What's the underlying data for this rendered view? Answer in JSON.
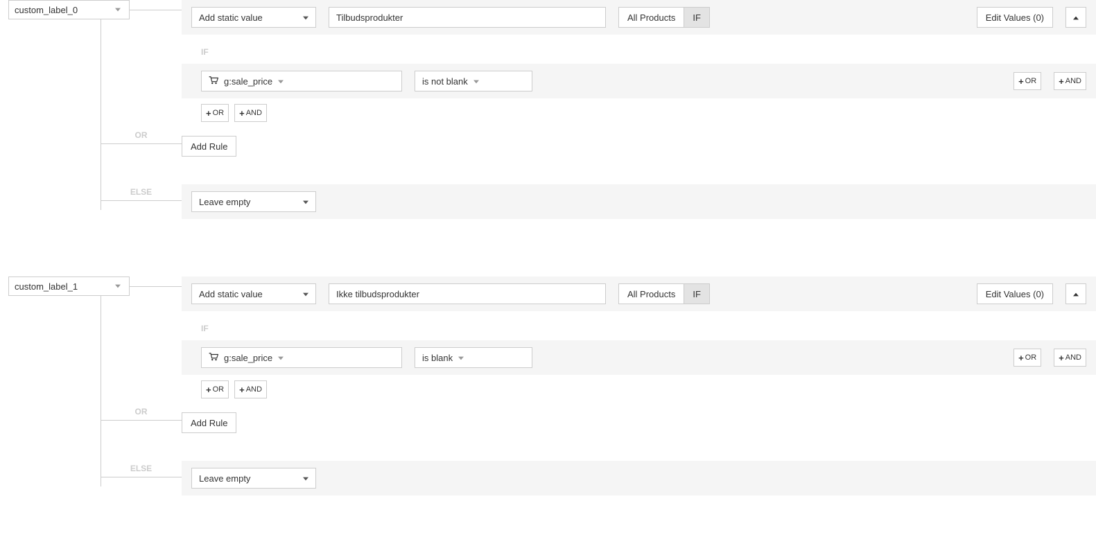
{
  "common": {
    "action_dropdown": "Add static value",
    "seg_all": "All Products",
    "seg_if": "IF",
    "edit_values": "Edit Values (0)",
    "if_label": "IF",
    "or_small": "OR",
    "and_small": "AND",
    "or_branch": "OR",
    "else_branch": "ELSE",
    "add_rule": "Add Rule",
    "leave_empty": "Leave empty",
    "cond_field": "g:sale_price"
  },
  "rules": [
    {
      "field": "custom_label_0",
      "value": "Tilbudsprodukter",
      "operator": "is not blank"
    },
    {
      "field": "custom_label_1",
      "value": "Ikke tilbudsprodukter",
      "operator": "is blank"
    }
  ]
}
